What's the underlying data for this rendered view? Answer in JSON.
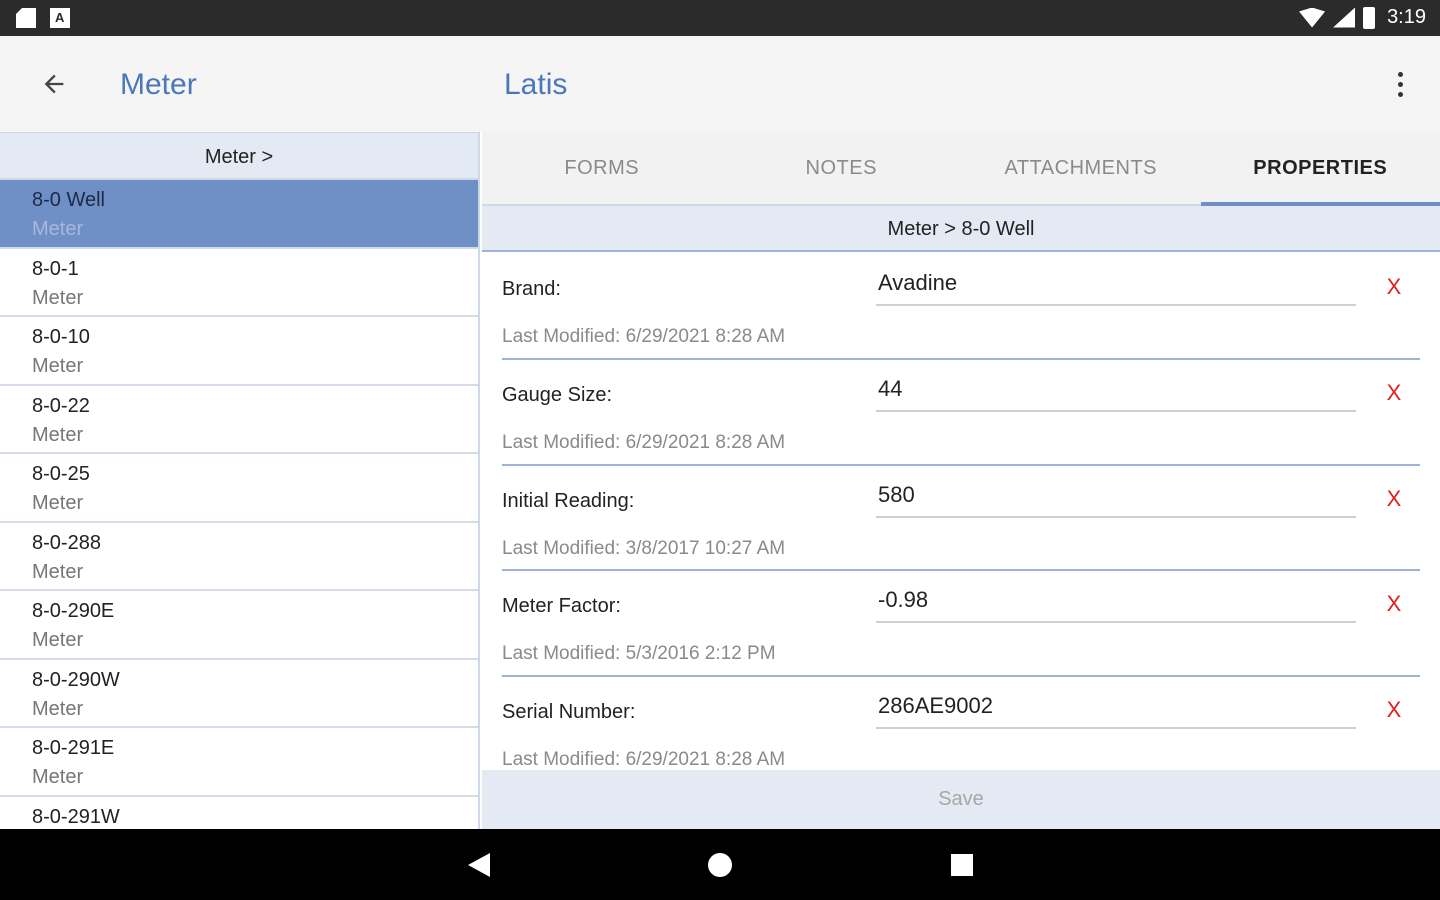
{
  "status_bar": {
    "time": "3:19",
    "left_icons": [
      "sd-card-icon",
      "a-notification-icon"
    ],
    "right_icons": [
      "wifi-icon",
      "signal-icon",
      "battery-icon"
    ]
  },
  "app_bar": {
    "left_title": "Meter",
    "right_title": "Latis",
    "back_icon": "arrow-back-icon",
    "menu_icon": "more-vert-icon"
  },
  "left_pane": {
    "header": "Meter >",
    "items": [
      {
        "name": "8-0 Well",
        "type": "Meter",
        "selected": true
      },
      {
        "name": "8-0-1",
        "type": "Meter"
      },
      {
        "name": "8-0-10",
        "type": "Meter"
      },
      {
        "name": "8-0-22",
        "type": "Meter"
      },
      {
        "name": "8-0-25",
        "type": "Meter"
      },
      {
        "name": "8-0-288",
        "type": "Meter"
      },
      {
        "name": "8-0-290E",
        "type": "Meter"
      },
      {
        "name": "8-0-290W",
        "type": "Meter"
      },
      {
        "name": "8-0-291E",
        "type": "Meter"
      },
      {
        "name": "8-0-291W",
        "type": ""
      }
    ]
  },
  "tabs": [
    {
      "label": "FORMS"
    },
    {
      "label": "NOTES"
    },
    {
      "label": "ATTACHMENTS"
    },
    {
      "label": "PROPERTIES",
      "active": true
    }
  ],
  "breadcrumb": "Meter > 8-0 Well",
  "properties": [
    {
      "label": "Brand:",
      "value": "Avadine",
      "clear": "X",
      "modified": "Last Modified: 6/29/2021 8:28 AM"
    },
    {
      "label": "Gauge Size:",
      "value": "44",
      "clear": "X",
      "modified": "Last Modified: 6/29/2021 8:28 AM"
    },
    {
      "label": "Initial Reading:",
      "value": "580",
      "clear": "X",
      "modified": "Last Modified: 3/8/2017 10:27 AM"
    },
    {
      "label": "Meter Factor:",
      "value": "-0.98",
      "clear": "X",
      "modified": "Last Modified: 5/3/2016 2:12 PM"
    },
    {
      "label": "Serial Number:",
      "value": "286AE9002",
      "clear": "X",
      "modified": "Last Modified: 6/29/2021 8:28 AM"
    }
  ],
  "save_label": "Save",
  "nav_bar": {
    "icons": [
      "nav-back-icon",
      "nav-home-icon",
      "nav-recents-icon"
    ]
  },
  "colors": {
    "accent": "#4a78b8",
    "selected_row": "#6f8fc7",
    "header_bg": "#e4eaf3",
    "clear_red": "#e02020"
  }
}
